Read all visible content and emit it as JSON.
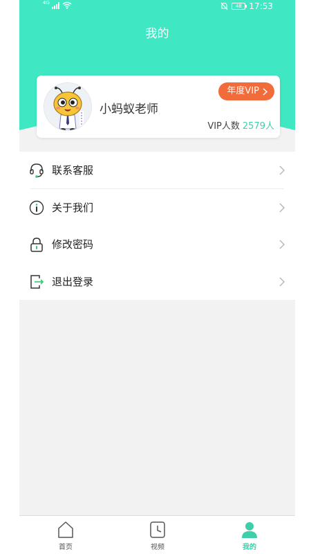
{
  "status_bar": {
    "network": "4G",
    "battery": "48",
    "time": "17:53"
  },
  "header": {
    "title": "我的"
  },
  "profile": {
    "name": "小蚂蚁老师",
    "vip_badge": "年度VIP",
    "vip_count_label": "VIP人数",
    "vip_count_value": "2579人"
  },
  "menu": [
    {
      "label": "联系客服",
      "icon": "headset-icon"
    },
    {
      "label": "关于我们",
      "icon": "info-icon"
    },
    {
      "label": "修改密码",
      "icon": "lock-icon"
    },
    {
      "label": "退出登录",
      "icon": "logout-icon"
    }
  ],
  "bottom_nav": [
    {
      "label": "首页",
      "icon": "home-icon",
      "active": false
    },
    {
      "label": "视频",
      "icon": "clock-icon",
      "active": false
    },
    {
      "label": "我的",
      "icon": "person-icon",
      "active": true
    }
  ],
  "colors": {
    "header": "#3fe8c3",
    "accent": "#3ecfa9",
    "vip_badge": "#f26b3a",
    "background": "#f2f2f2"
  }
}
